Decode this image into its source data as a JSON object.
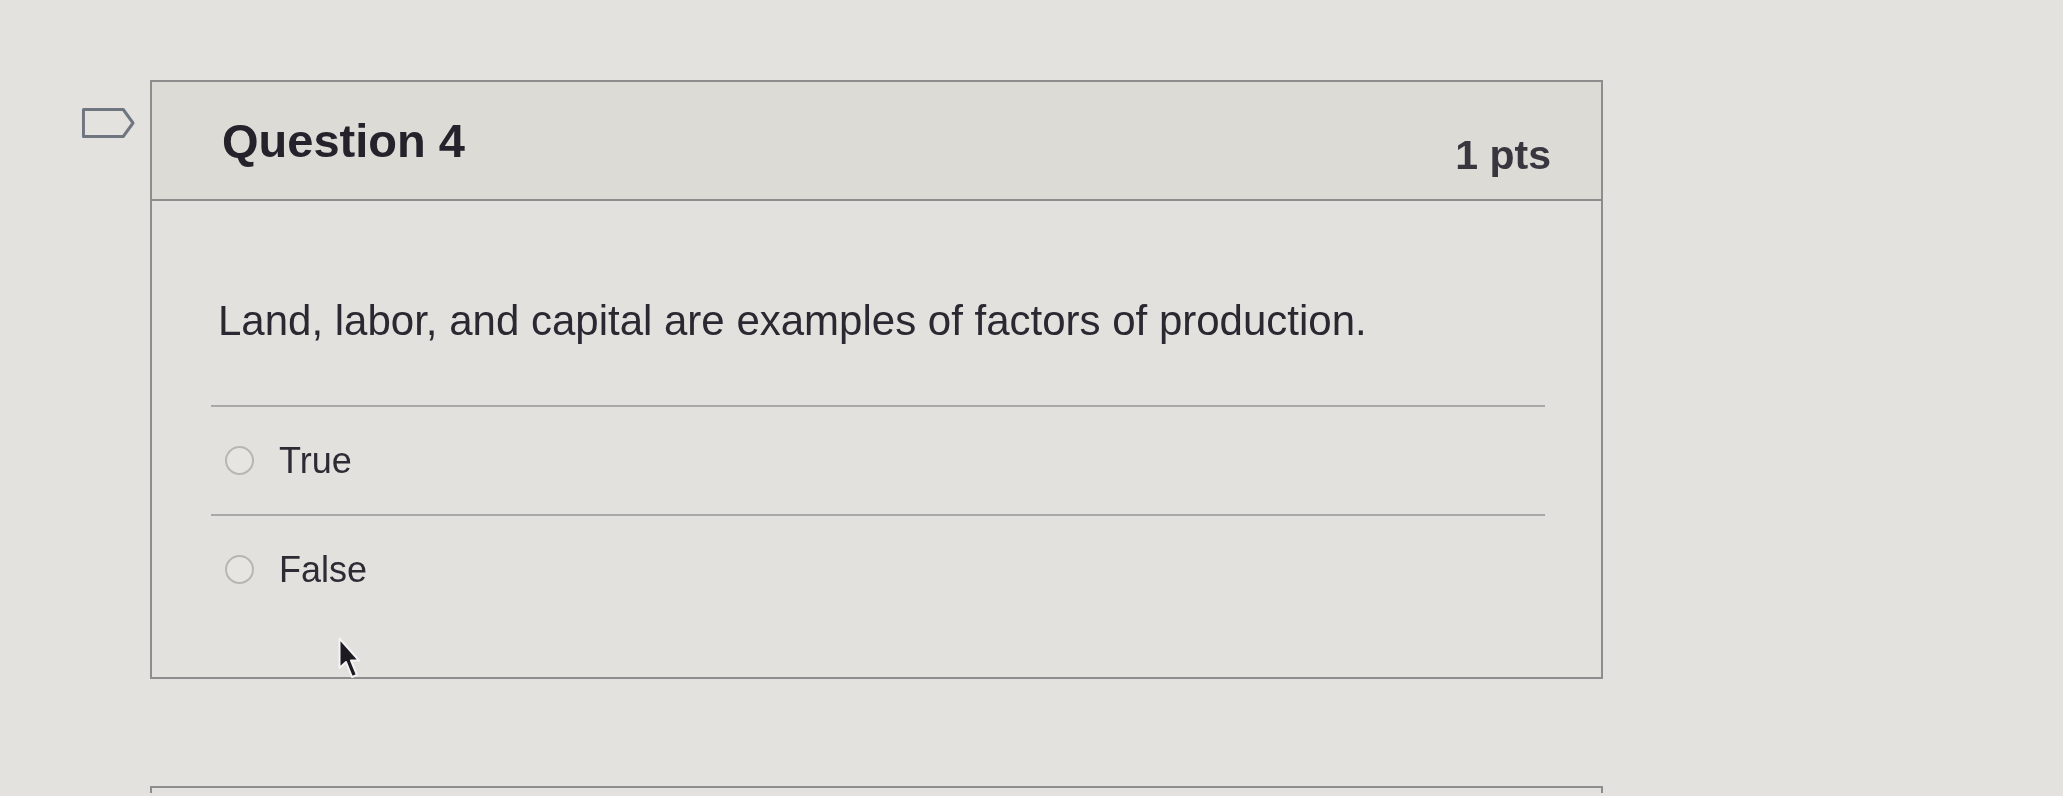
{
  "question": {
    "flagged": false,
    "title": "Question 4",
    "points": "1 pts",
    "text": "Land, labor, and capital are examples of factors of production.",
    "answers": [
      {
        "label": "True",
        "selected": false
      },
      {
        "label": "False",
        "selected": false
      }
    ]
  }
}
